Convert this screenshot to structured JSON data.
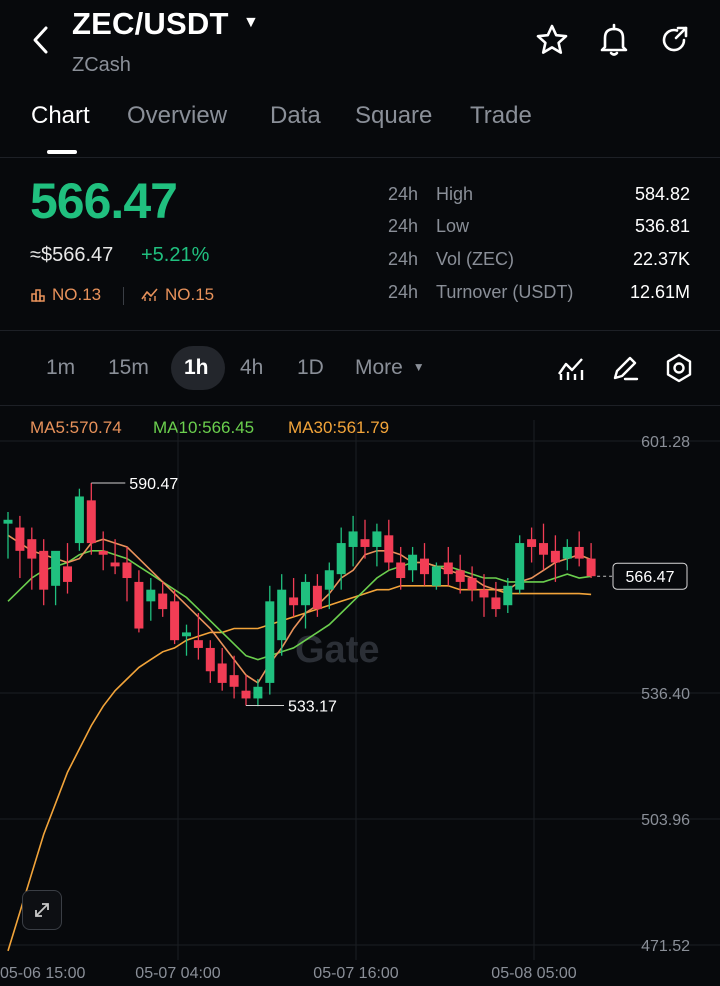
{
  "header": {
    "pair": "ZEC/USDT",
    "name": "ZCash"
  },
  "tabs": [
    {
      "label": "Chart",
      "active": true
    },
    {
      "label": "Overview"
    },
    {
      "label": "Data"
    },
    {
      "label": "Square"
    },
    {
      "label": "Trade"
    }
  ],
  "price": {
    "last": "566.47",
    "usd": "≈$566.47",
    "change": "+5.21%",
    "rank1": "NO.13",
    "rank2": "NO.15"
  },
  "stats": [
    {
      "period": "24h",
      "name": "High",
      "value": "584.82"
    },
    {
      "period": "24h",
      "name": "Low",
      "value": "536.81"
    },
    {
      "period": "24h",
      "name": "Vol (ZEC)",
      "value": "22.37K"
    },
    {
      "period": "24h",
      "name": "Turnover (USDT)",
      "value": "12.61M"
    }
  ],
  "intervals": [
    {
      "label": "1m"
    },
    {
      "label": "15m"
    },
    {
      "label": "1h",
      "active": true
    },
    {
      "label": "4h"
    },
    {
      "label": "1D"
    },
    {
      "label": "More"
    }
  ],
  "ma": {
    "ma5": "MA5:570.74",
    "ma10": "MA10:566.45",
    "ma30": "MA30:561.79"
  },
  "colors": {
    "up": "#20c07f",
    "down": "#f23d55",
    "ma5": "#e8925b",
    "ma10": "#6bcf4e",
    "ma30": "#f2a43a",
    "grid": "#1b1e23"
  },
  "chart_data": {
    "type": "candlestick",
    "y_ticks": [
      "601.28",
      "536.40",
      "503.96",
      "471.52"
    ],
    "x_ticks": [
      "05-06 15:00",
      "05-07 04:00",
      "05-07 16:00",
      "05-08 05:00"
    ],
    "annotations": {
      "high": "590.47",
      "low": "533.17"
    },
    "last_price_label": "566.47",
    "candles": [
      {
        "o": 580,
        "h": 583,
        "l": 571,
        "c": 581
      },
      {
        "o": 579,
        "h": 582,
        "l": 566,
        "c": 573
      },
      {
        "o": 576,
        "h": 579,
        "l": 563,
        "c": 571
      },
      {
        "o": 573,
        "h": 576,
        "l": 559,
        "c": 563
      },
      {
        "o": 564,
        "h": 572,
        "l": 559,
        "c": 573
      },
      {
        "o": 569,
        "h": 575,
        "l": 562,
        "c": 565
      },
      {
        "o": 575,
        "h": 589,
        "l": 573,
        "c": 587
      },
      {
        "o": 586,
        "h": 590.47,
        "l": 572,
        "c": 575
      },
      {
        "o": 573,
        "h": 578,
        "l": 568,
        "c": 572
      },
      {
        "o": 570,
        "h": 576,
        "l": 567,
        "c": 569
      },
      {
        "o": 570,
        "h": 574,
        "l": 560,
        "c": 566
      },
      {
        "o": 565,
        "h": 568,
        "l": 552,
        "c": 553
      },
      {
        "o": 560,
        "h": 566,
        "l": 555,
        "c": 563
      },
      {
        "o": 562,
        "h": 565,
        "l": 556,
        "c": 558
      },
      {
        "o": 560,
        "h": 563,
        "l": 549,
        "c": 550
      },
      {
        "o": 551,
        "h": 554,
        "l": 546,
        "c": 552
      },
      {
        "o": 550,
        "h": 557,
        "l": 545,
        "c": 548
      },
      {
        "o": 548,
        "h": 550,
        "l": 539,
        "c": 542
      },
      {
        "o": 544,
        "h": 548,
        "l": 537,
        "c": 539
      },
      {
        "o": 541,
        "h": 546,
        "l": 535,
        "c": 538
      },
      {
        "o": 537,
        "h": 541,
        "l": 533.17,
        "c": 535
      },
      {
        "o": 535,
        "h": 540,
        "l": 533,
        "c": 538
      },
      {
        "o": 539,
        "h": 564,
        "l": 536,
        "c": 560
      },
      {
        "o": 550,
        "h": 567,
        "l": 546,
        "c": 563
      },
      {
        "o": 561,
        "h": 566,
        "l": 556,
        "c": 559
      },
      {
        "o": 559,
        "h": 567,
        "l": 553,
        "c": 565
      },
      {
        "o": 564,
        "h": 567,
        "l": 556,
        "c": 558
      },
      {
        "o": 563,
        "h": 570,
        "l": 558,
        "c": 568
      },
      {
        "o": 567,
        "h": 579,
        "l": 563,
        "c": 575
      },
      {
        "o": 574,
        "h": 582,
        "l": 569,
        "c": 578
      },
      {
        "o": 576,
        "h": 581,
        "l": 571,
        "c": 574
      },
      {
        "o": 574,
        "h": 580,
        "l": 569,
        "c": 578
      },
      {
        "o": 577,
        "h": 581,
        "l": 568,
        "c": 570
      },
      {
        "o": 570,
        "h": 574,
        "l": 563,
        "c": 566
      },
      {
        "o": 568,
        "h": 574,
        "l": 565,
        "c": 572
      },
      {
        "o": 571,
        "h": 575,
        "l": 564,
        "c": 567
      },
      {
        "o": 564,
        "h": 570,
        "l": 563,
        "c": 569
      },
      {
        "o": 570,
        "h": 574,
        "l": 564,
        "c": 567
      },
      {
        "o": 568,
        "h": 572,
        "l": 562,
        "c": 565
      },
      {
        "o": 566,
        "h": 569,
        "l": 560,
        "c": 563
      },
      {
        "o": 563,
        "h": 567,
        "l": 556,
        "c": 561
      },
      {
        "o": 561,
        "h": 565,
        "l": 556,
        "c": 558
      },
      {
        "o": 559,
        "h": 566,
        "l": 557,
        "c": 564
      },
      {
        "o": 563,
        "h": 577,
        "l": 562,
        "c": 575
      },
      {
        "o": 576,
        "h": 579,
        "l": 570,
        "c": 574
      },
      {
        "o": 575,
        "h": 580,
        "l": 568,
        "c": 572
      },
      {
        "o": 573,
        "h": 577,
        "l": 565,
        "c": 570
      },
      {
        "o": 571,
        "h": 576,
        "l": 568,
        "c": 574
      },
      {
        "o": 574,
        "h": 578,
        "l": 569,
        "c": 571
      },
      {
        "o": 571,
        "h": 575,
        "l": 566,
        "c": 566.47
      }
    ],
    "ma5": [
      577,
      575,
      573,
      572,
      571,
      570,
      571,
      575,
      576,
      575,
      574,
      571,
      568,
      565,
      562,
      559,
      556,
      553,
      549,
      545,
      541,
      539,
      544,
      548,
      553,
      557,
      559,
      562,
      566,
      568,
      572,
      573,
      573,
      572,
      570,
      570,
      569,
      568,
      567,
      566,
      564,
      563,
      563,
      565,
      566,
      568,
      570,
      571,
      572,
      570.74
    ],
    "ma10": [
      560,
      563,
      566,
      568,
      569,
      570,
      572,
      573,
      573,
      572,
      571,
      569,
      567,
      565,
      563,
      561,
      558,
      555,
      552,
      549,
      546,
      545,
      546,
      547,
      548,
      550,
      552,
      554,
      557,
      560,
      563,
      566,
      568,
      569,
      570,
      570,
      569,
      569,
      568,
      567,
      566,
      566,
      565,
      565,
      565,
      565,
      566,
      567,
      566,
      566.45
    ],
    "ma30": [
      470,
      480,
      490,
      500,
      508,
      516,
      522,
      528,
      533,
      537,
      540,
      543,
      545,
      547,
      548,
      550,
      551,
      552,
      552,
      553,
      553,
      553,
      554,
      555,
      556,
      557,
      558,
      559,
      560,
      561,
      562,
      563,
      563,
      564,
      564,
      564,
      564,
      564,
      563,
      563,
      563,
      563,
      562,
      562,
      562,
      562,
      562,
      562,
      562,
      561.79
    ]
  }
}
